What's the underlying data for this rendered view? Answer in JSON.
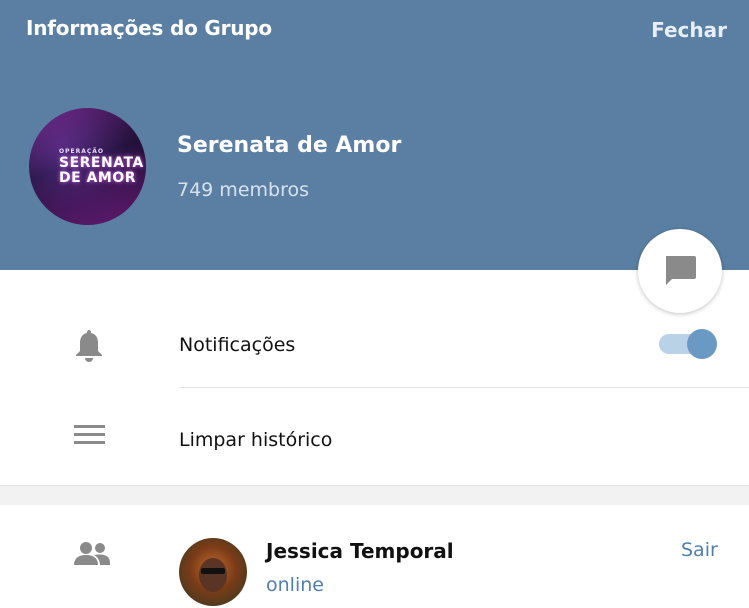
{
  "header": {
    "title": "Informações do Grupo",
    "close_label": "Fechar",
    "background": "#5a7fa3"
  },
  "group": {
    "name": "Serenata de Amor",
    "members": "749 membros",
    "avatar": {
      "small_text": "OPERAÇÃO",
      "line1": "SERENATA",
      "line2": "DE AMOR"
    }
  },
  "fab": {
    "icon": "message-icon"
  },
  "settings": {
    "notifications": {
      "label": "Notificações",
      "icon": "bell-icon",
      "enabled": true
    },
    "clear_history": {
      "label": "Limpar histórico",
      "icon": "menu-lines-icon"
    }
  },
  "members_section": {
    "icon": "people-icon",
    "member": {
      "name": "Jessica Temporal",
      "status": "online",
      "action_label": "Sair"
    }
  },
  "colors": {
    "accent": "#4f7fae",
    "toggle_on": "#6a99c4",
    "toggle_track": "#b9d2e8",
    "icon_gray": "#8a8a8a"
  }
}
